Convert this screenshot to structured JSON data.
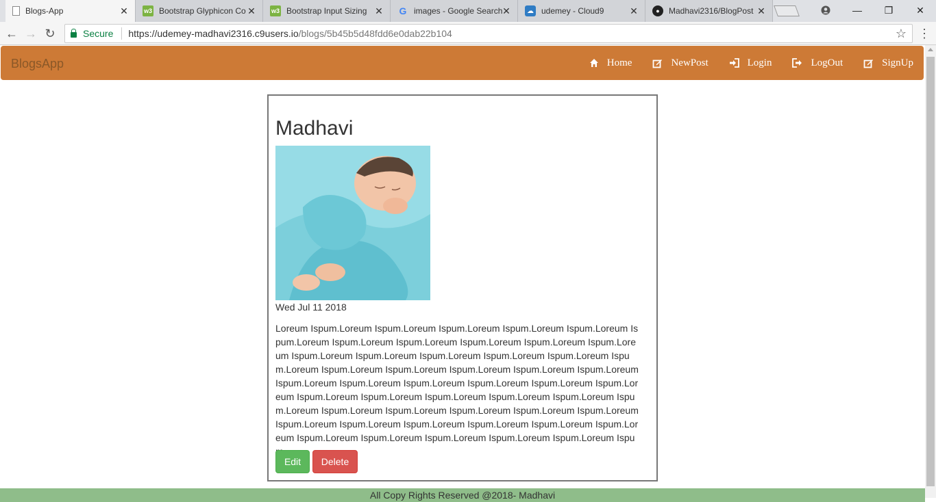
{
  "browser": {
    "tabs": [
      {
        "title": "Blogs-App",
        "favicon": "page-icon",
        "active": true
      },
      {
        "title": "Bootstrap Glyphicon Co",
        "favicon": "w3schools-icon",
        "active": false
      },
      {
        "title": "Bootstrap Input Sizing",
        "favicon": "w3schools-icon",
        "active": false
      },
      {
        "title": "images - Google Search",
        "favicon": "google-icon",
        "active": false
      },
      {
        "title": "udemey - Cloud9",
        "favicon": "cloud9-icon",
        "active": false
      },
      {
        "title": "Madhavi2316/BlogPost",
        "favicon": "github-icon",
        "active": false
      }
    ],
    "address": {
      "secure_label": "Secure",
      "url_host": "https://udemey-madhavi2316.c9users.io",
      "url_path": "/blogs/5b45b5d48fdd6e0dab22b104"
    }
  },
  "navbar": {
    "brand": "BlogsApp",
    "links": [
      {
        "label": "Home",
        "icon": "home-icon"
      },
      {
        "label": "NewPost",
        "icon": "edit-icon"
      },
      {
        "label": "Login",
        "icon": "log-in-icon"
      },
      {
        "label": "LogOut",
        "icon": "log-out-icon"
      },
      {
        "label": "SignUp",
        "icon": "edit-icon"
      }
    ],
    "background_color": "#cd7a36"
  },
  "post": {
    "title": "Madhavi",
    "image_alt": "sleeping baby wrapped in blue blanket",
    "date": "Wed Jul 11 2018",
    "body": "Loreum Ispum.Loreum Ispum.Loreum Ispum.Loreum Ispum.Loreum Ispum.Loreum Ispum.Loreum Ispum.Loreum Ispum.Loreum Ispum.Loreum Ispum.Loreum Ispum.Loreum Ispum.Loreum Ispum.Loreum Ispum.Loreum Ispum.Loreum Ispum.Loreum Ispum.Loreum Ispum.Loreum Ispum.Loreum Ispum.Loreum Ispum.Loreum Ispum.Loreum Ispum.Loreum Ispum.Loreum Ispum.Loreum Ispum.Loreum Ispum.Loreum Ispum.Loreum Ispum.Loreum Ispum.Loreum Ispum.Loreum Ispum.Loreum Ispum.Loreum Ispum.Loreum Ispum.Loreum Ispum.Loreum Ispum.Loreum Ispum.Loreum Ispum.Loreum Ispum.Loreum Ispum.Loreum Ispum.Loreum Ispum.Loreum Ispum.Loreum Ispum.Loreum Ispum.Loreum Ispum.Loreum Ispum.Loreum Ispum.Loreum Ispum.Loreum Ispum.",
    "edit_label": "Edit",
    "delete_label": "Delete"
  },
  "footer": {
    "text": "All Copy Rights Reserved @2018- Madhavi"
  }
}
